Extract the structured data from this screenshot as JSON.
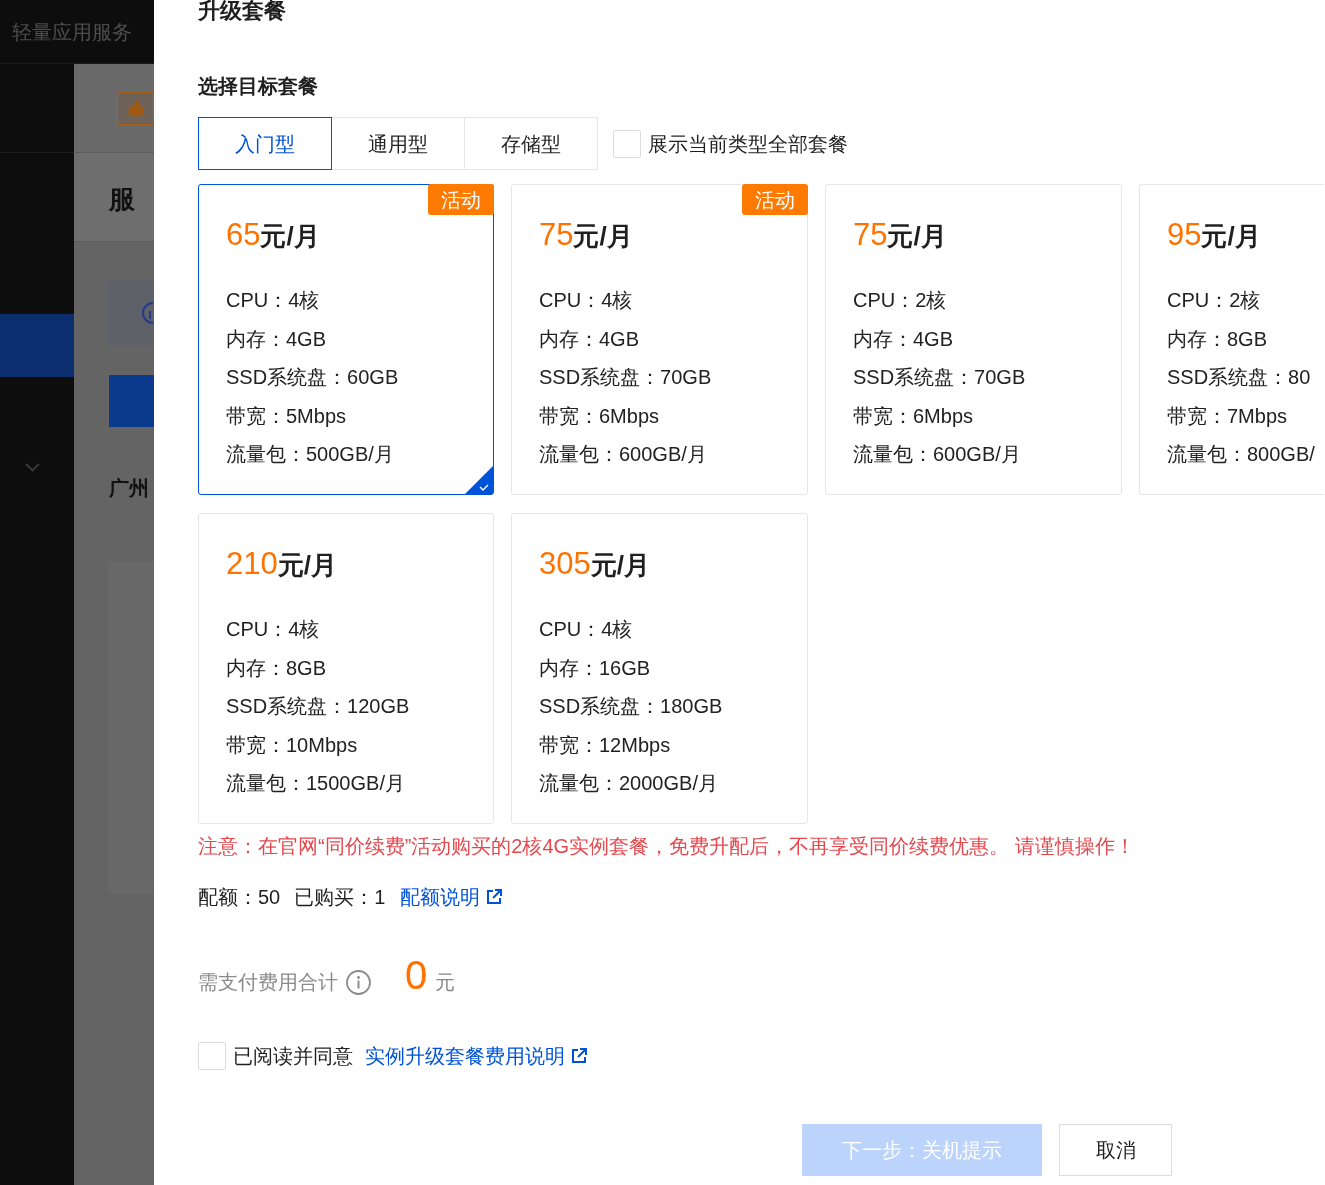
{
  "background": {
    "app_title": "轻量应用服务",
    "sidebar": {
      "active_item": {
        "selected": true
      },
      "menu_group": {
        "expanded": false
      }
    },
    "page_heading": "服",
    "region_label": "广州"
  },
  "drawer": {
    "title": "升级套餐",
    "section_title": "选择目标套餐"
  },
  "tabs": [
    {
      "label": "入门型",
      "selected": true
    },
    {
      "label": "通用型",
      "selected": false
    },
    {
      "label": "存储型",
      "selected": false
    }
  ],
  "show_all": {
    "label": "展示当前类型全部套餐",
    "checked": false
  },
  "plans": [
    {
      "price": "65",
      "unit": "元/月",
      "badge": "活动",
      "selected": true,
      "specs": [
        "CPU：4核",
        "内存：4GB",
        "SSD系统盘：60GB",
        "带宽：5Mbps",
        "流量包：500GB/月"
      ]
    },
    {
      "price": "75",
      "unit": "元/月",
      "badge": "活动",
      "selected": false,
      "specs": [
        "CPU：4核",
        "内存：4GB",
        "SSD系统盘：70GB",
        "带宽：6Mbps",
        "流量包：600GB/月"
      ]
    },
    {
      "price": "75",
      "unit": "元/月",
      "selected": false,
      "specs": [
        "CPU：2核",
        "内存：4GB",
        "SSD系统盘：70GB",
        "带宽：6Mbps",
        "流量包：600GB/月"
      ]
    },
    {
      "price": "95",
      "unit": "元/月",
      "selected": false,
      "specs": [
        "CPU：2核",
        "内存：8GB",
        "SSD系统盘：80",
        "带宽：7Mbps",
        "流量包：800GB/"
      ]
    },
    {
      "price": "210",
      "unit": "元/月",
      "selected": false,
      "specs": [
        "CPU：4核",
        "内存：8GB",
        "SSD系统盘：120GB",
        "带宽：10Mbps",
        "流量包：1500GB/月"
      ]
    },
    {
      "price": "305",
      "unit": "元/月",
      "selected": false,
      "specs": [
        "CPU：4核",
        "内存：16GB",
        "SSD系统盘：180GB",
        "带宽：12Mbps",
        "流量包：2000GB/月"
      ]
    }
  ],
  "warning": "注意：在官网“同价续费”活动购买的2核4G实例套餐，免费升配后，不再享受同价续费优惠。 请谨慎操作！",
  "quota": {
    "total": "配额：50",
    "purchased": "已购买：1",
    "link": "配额说明"
  },
  "total": {
    "label": "需支付费用合计",
    "amount": "0",
    "currency": "元"
  },
  "agreement": {
    "checked": false,
    "text": "已阅读并同意",
    "link": "实例升级套餐费用说明"
  },
  "buttons": [
    {
      "label": "下一步：关机提示",
      "kind": "primary",
      "disabled": true
    },
    {
      "label": "取消",
      "kind": "secondary",
      "disabled": false
    }
  ]
}
